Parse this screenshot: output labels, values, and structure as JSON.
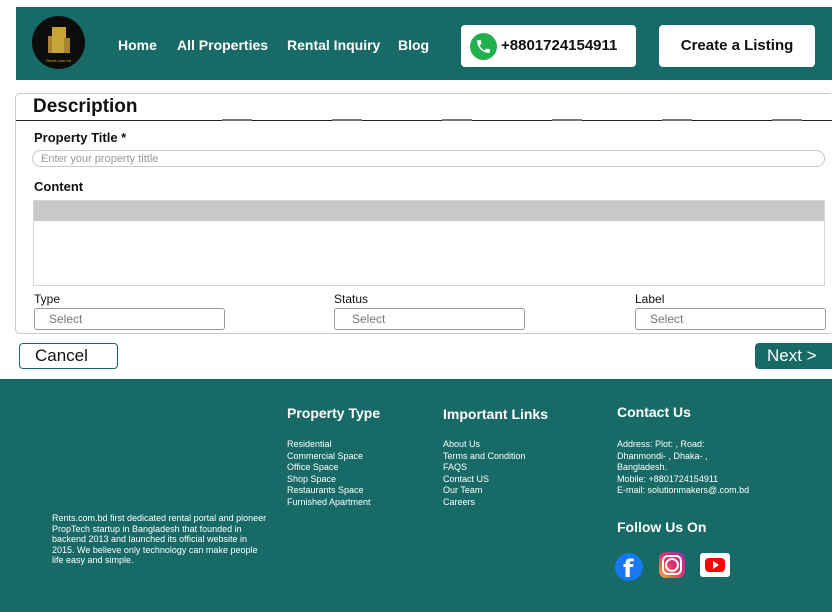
{
  "header": {
    "logo_icon": "building-logo-icon",
    "logo_text": "Rents.com.bd",
    "nav": [
      "Home",
      "All Properties",
      "Rental Inquiry",
      "Blog"
    ],
    "phone_icon": "phone-icon",
    "phone": "+8801724154911",
    "create_listing": "Create a Listing"
  },
  "form": {
    "section_title": "Description",
    "property_title_label": "Property Title *",
    "property_title_placeholder": "Enter your property tittle",
    "property_title_value": "",
    "content_label": "Content",
    "type_label": "Type",
    "type_value": "Select",
    "status_label": "Status",
    "status_value": "Select",
    "label_label": "Label",
    "label_value": "Select",
    "cancel": "Cancel",
    "next": "Next >"
  },
  "footer": {
    "about": "Rents.com.bd first dedicated rental portal and pioneer PropTech startup in Bangladesh  that founded in backend 2013 and launched its official website in 2015. We believe only  technology can make people life easy and simple.",
    "property_type": {
      "heading": "Property Type",
      "items": [
        "Residential",
        "Commercial Space",
        "Office Space",
        "Shop Space",
        "Restaurants Space",
        "Furnished Apartment"
      ]
    },
    "important_links": {
      "heading": "Important Links",
      "items": [
        "About Us",
        "Terms and Condition",
        "FAQS",
        "Contact US",
        "Our Team",
        "Careers"
      ]
    },
    "contact": {
      "heading": "Contact Us",
      "lines": [
        "Address: Plot: , Road:",
        "Dhanmondi- , Dhaka- ,",
        "Bangladesh.",
        "Mobile: +8801724154911",
        "E-mail: solutionmakers@.com.bd"
      ]
    },
    "follow": {
      "heading": "Follow Us On",
      "icons": [
        "facebook-icon",
        "instagram-icon",
        "youtube-icon"
      ]
    }
  },
  "colors": {
    "brand": "#176a66",
    "phone_green": "#21b04b",
    "facebook": "#1877f2",
    "youtube": "#ff0000"
  }
}
